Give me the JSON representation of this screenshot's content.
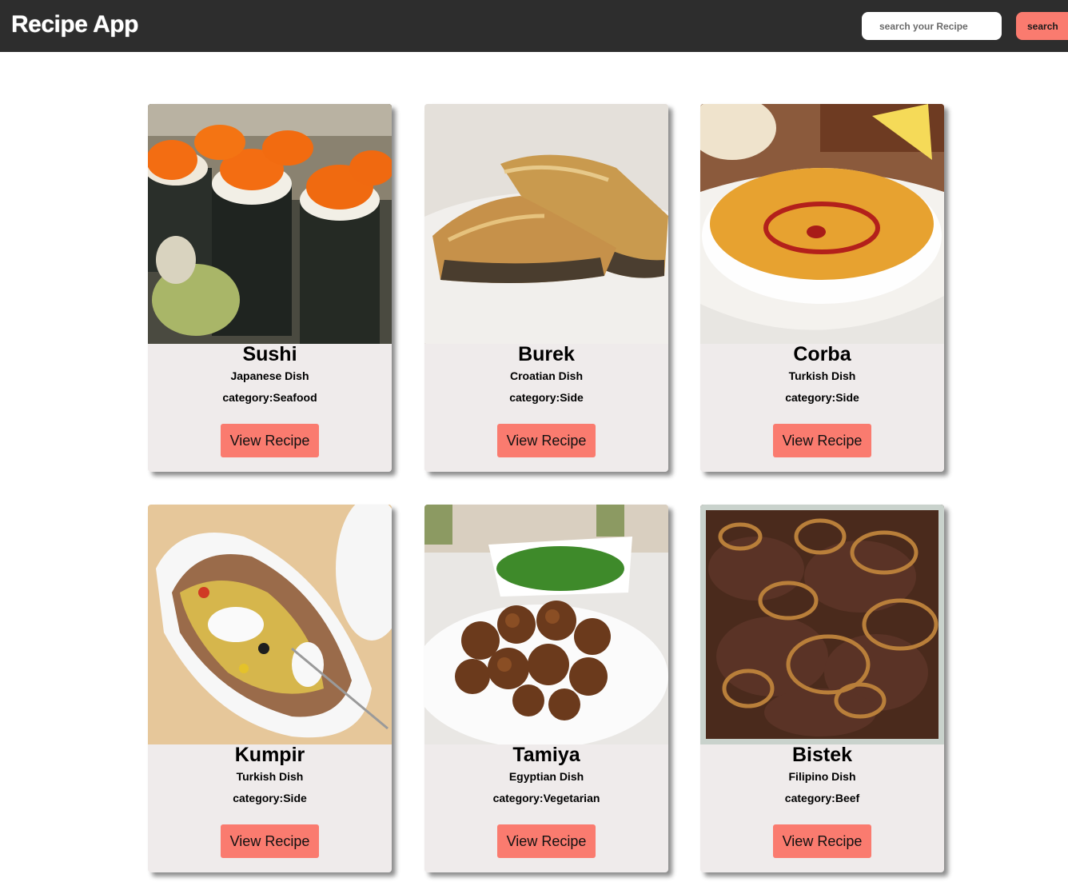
{
  "app": {
    "title": "Recipe App"
  },
  "search": {
    "placeholder": "search your Recipe",
    "button_label": "search"
  },
  "colors": {
    "header": "#2d2d2d",
    "accent": "#fa7b6f",
    "card": "#efebeb"
  },
  "recipes": [
    {
      "name": "Sushi",
      "origin": "Japanese Dish",
      "category_label": "category:",
      "category": "Seafood",
      "button_label": "View Recipe",
      "image": "sushi-photo"
    },
    {
      "name": "Burek",
      "origin": "Croatian Dish",
      "category_label": "category:",
      "category": "Side",
      "button_label": "View Recipe",
      "image": "burek-photo"
    },
    {
      "name": "Corba",
      "origin": "Turkish Dish",
      "category_label": "category:",
      "category": "Side",
      "button_label": "View Recipe",
      "image": "corba-photo"
    },
    {
      "name": "Kumpir",
      "origin": "Turkish Dish",
      "category_label": "category:",
      "category": "Side",
      "button_label": "View Recipe",
      "image": "kumpir-photo"
    },
    {
      "name": "Tamiya",
      "origin": "Egyptian Dish",
      "category_label": "category:",
      "category": "Vegetarian",
      "button_label": "View Recipe",
      "image": "tamiya-photo"
    },
    {
      "name": "Bistek",
      "origin": "Filipino Dish",
      "category_label": "category:",
      "category": "Beef",
      "button_label": "View Recipe",
      "image": "bistek-photo"
    }
  ]
}
